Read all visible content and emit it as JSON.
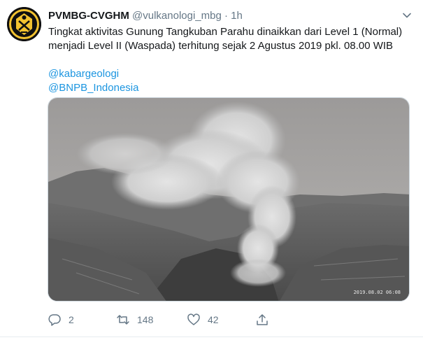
{
  "tweet": {
    "author_name": "PVMBG-CVGHM",
    "handle": "@vulkanologi_mbg",
    "separator": "·",
    "time": "1h",
    "text_lines": [
      "Tingkat aktivitas Gunung Tangkuban Parahu dinaikkan dari Level 1 (Normal)",
      "menjadi Level II (Waspada) terhitung sejak 2 Agustus 2019 pkl. 08.00 WIB"
    ],
    "mentions": [
      "@kabargeologi",
      "@BNPB_Indonesia"
    ],
    "media": {
      "timestamp": "2019.08.02 06:08"
    },
    "actions": {
      "replies": "2",
      "retweets": "148",
      "likes": "42"
    },
    "colors": {
      "link": "#1b95e0",
      "secondary": "#657786"
    },
    "icons": [
      "avatar-emblem-icon",
      "chevron-down-icon",
      "reply-icon",
      "retweet-icon",
      "like-icon",
      "share-icon"
    ]
  }
}
